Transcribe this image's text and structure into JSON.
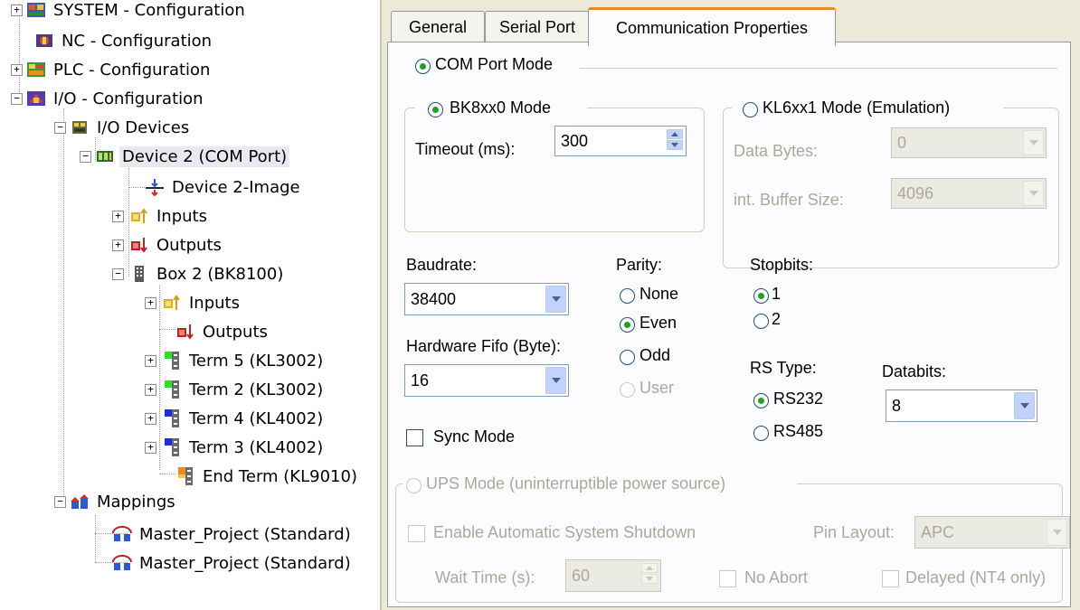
{
  "tree": {
    "items": [
      {
        "label": "SYSTEM - Configuration"
      },
      {
        "label": "NC - Configuration"
      },
      {
        "label": "PLC - Configuration"
      },
      {
        "label": "I/O - Configuration"
      },
      {
        "label": "I/O Devices"
      },
      {
        "label": "Device 2 (COM Port)"
      },
      {
        "label": "Device 2-Image"
      },
      {
        "label": "Inputs"
      },
      {
        "label": "Outputs"
      },
      {
        "label": "Box 2 (BK8100)"
      },
      {
        "label": "Inputs"
      },
      {
        "label": "Outputs"
      },
      {
        "label": "Term 5 (KL3002)"
      },
      {
        "label": "Term 2 (KL3002)"
      },
      {
        "label": "Term 4 (KL4002)"
      },
      {
        "label": "Term 3 (KL4002)"
      },
      {
        "label": "End Term (KL9010)"
      },
      {
        "label": "Mappings"
      },
      {
        "label": "Master_Project (Standard)"
      },
      {
        "label": "Master_Project (Standard)"
      }
    ]
  },
  "tabs": [
    {
      "label": "General"
    },
    {
      "label": "Serial Port"
    },
    {
      "label": "Communication Properties"
    }
  ],
  "comm": {
    "com_port_mode": "COM Port Mode",
    "bk_mode": "BK8xx0 Mode",
    "timeout_label": "Timeout (ms):",
    "timeout_value": "300",
    "kl_mode": "KL6xx1 Mode (Emulation)",
    "data_bytes_label": "Data Bytes:",
    "data_bytes_value": "0",
    "buffer_label": "int. Buffer Size:",
    "buffer_value": "4096",
    "baudrate_label": "Baudrate:",
    "baudrate_value": "38400",
    "fifo_label": "Hardware Fifo (Byte):",
    "fifo_value": "16",
    "parity_label": "Parity:",
    "parity_none": "None",
    "parity_even": "Even",
    "parity_odd": "Odd",
    "parity_user": "User",
    "stopbits_label": "Stopbits:",
    "stop_1": "1",
    "stop_2": "2",
    "rs_type_label": "RS Type:",
    "rs232": "RS232",
    "rs485": "RS485",
    "databits_label": "Databits:",
    "databits_value": "8",
    "sync_mode": "Sync Mode"
  },
  "ups": {
    "mode": "UPS Mode (uninterruptible power source)",
    "shutdown": "Enable Automatic System Shutdown",
    "pin_layout_label": "Pin Layout:",
    "pin_layout_value": "APC",
    "wait_time_label": "Wait Time (s):",
    "wait_time_value": "60",
    "no_abort": "No Abort",
    "delayed": "Delayed (NT4 only)"
  }
}
